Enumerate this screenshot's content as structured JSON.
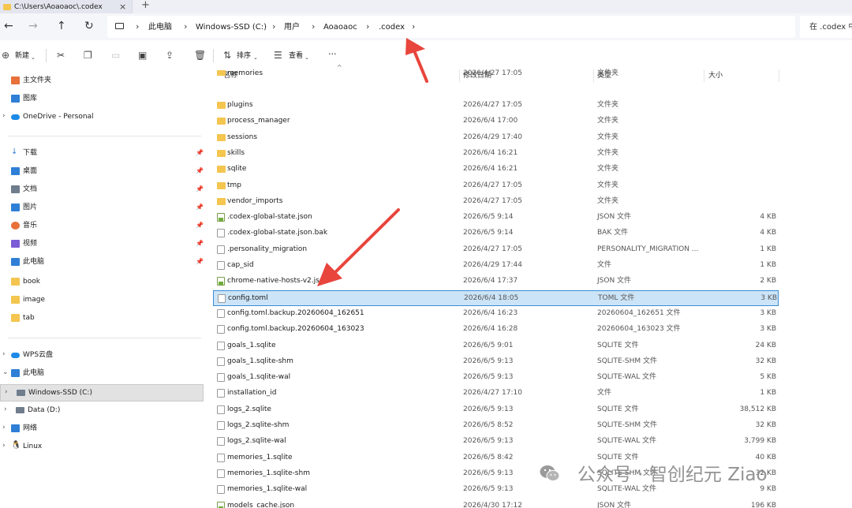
{
  "window": {
    "tab_title": "C:\\Users\\Aoaoaoc\\.codex",
    "tab_close": "×",
    "tab_add": "+"
  },
  "address": {
    "crumbs": [
      "此电脑",
      "Windows-SSD (C:)",
      "用户",
      "Aoaoaoc",
      ".codex"
    ],
    "search_placeholder": "在 .codex 中"
  },
  "toolbar": {
    "new_label": "新建",
    "sort_label": "排序",
    "view_label": "查看",
    "more_label": "···"
  },
  "sidebar": {
    "top": [
      {
        "label": "主文件夹",
        "icon": "home-icon"
      },
      {
        "label": "图库",
        "icon": "gallery-icon"
      },
      {
        "label": "OneDrive - Personal",
        "icon": "onedrive-icon"
      }
    ],
    "quick": [
      {
        "label": "下载",
        "icon": "download-icon",
        "pinned": true
      },
      {
        "label": "桌面",
        "icon": "desktop-icon",
        "pinned": true
      },
      {
        "label": "文档",
        "icon": "documents-icon",
        "pinned": true
      },
      {
        "label": "图片",
        "icon": "pictures-icon",
        "pinned": true
      },
      {
        "label": "音乐",
        "icon": "music-icon",
        "pinned": true
      },
      {
        "label": "视频",
        "icon": "videos-icon",
        "pinned": true
      },
      {
        "label": "此电脑",
        "icon": "this-pc-icon",
        "pinned": true
      },
      {
        "label": "book",
        "icon": "folder-icon",
        "pinned": false
      },
      {
        "label": "image",
        "icon": "folder-icon",
        "pinned": false
      },
      {
        "label": "tab",
        "icon": "folder-icon",
        "pinned": false
      }
    ],
    "tree": [
      {
        "label": "WPS云盘",
        "icon": "wps-cloud-icon"
      },
      {
        "label": "此电脑",
        "icon": "this-pc-icon"
      },
      {
        "label": "Windows-SSD (C:)",
        "icon": "drive-icon",
        "selected": true
      },
      {
        "label": "Data (D:)",
        "icon": "drive-icon"
      },
      {
        "label": "网络",
        "icon": "network-icon"
      },
      {
        "label": "Linux",
        "icon": "linux-icon"
      }
    ]
  },
  "columns": {
    "name": "名称",
    "date": "修改日期",
    "type": "类型",
    "size": "大小"
  },
  "files": [
    {
      "name": "memories",
      "date": "2026/4/27 17:05",
      "type": "文件夹",
      "size": "",
      "kind": "folder"
    },
    {
      "name": "plugins",
      "date": "2026/4/27 17:05",
      "type": "文件夹",
      "size": "",
      "kind": "folder"
    },
    {
      "name": "process_manager",
      "date": "2026/6/4 17:00",
      "type": "文件夹",
      "size": "",
      "kind": "folder"
    },
    {
      "name": "sessions",
      "date": "2026/4/29 17:40",
      "type": "文件夹",
      "size": "",
      "kind": "folder"
    },
    {
      "name": "skills",
      "date": "2026/6/4 16:21",
      "type": "文件夹",
      "size": "",
      "kind": "folder"
    },
    {
      "name": "sqlite",
      "date": "2026/6/4 16:21",
      "type": "文件夹",
      "size": "",
      "kind": "folder"
    },
    {
      "name": "tmp",
      "date": "2026/4/27 17:05",
      "type": "文件夹",
      "size": "",
      "kind": "folder"
    },
    {
      "name": "vendor_imports",
      "date": "2026/4/27 17:05",
      "type": "文件夹",
      "size": "",
      "kind": "folder"
    },
    {
      "name": ".codex-global-state.json",
      "date": "2026/6/5 9:14",
      "type": "JSON 文件",
      "size": "4 KB",
      "kind": "json"
    },
    {
      "name": ".codex-global-state.json.bak",
      "date": "2026/6/5 9:14",
      "type": "BAK 文件",
      "size": "4 KB",
      "kind": "doc"
    },
    {
      "name": ".personality_migration",
      "date": "2026/4/27 17:05",
      "type": "PERSONALITY_MIGRATION ...",
      "size": "1 KB",
      "kind": "doc"
    },
    {
      "name": "cap_sid",
      "date": "2026/4/29 17:44",
      "type": "文件",
      "size": "1 KB",
      "kind": "doc"
    },
    {
      "name": "chrome-native-hosts-v2.json",
      "date": "2026/6/4 17:37",
      "type": "JSON 文件",
      "size": "2 KB",
      "kind": "json"
    },
    {
      "name": "config.toml",
      "date": "2026/6/4 18:05",
      "type": "TOML 文件",
      "size": "3 KB",
      "kind": "doc",
      "selected": true
    },
    {
      "name": "config.toml.backup.20260604_162651",
      "date": "2026/6/4 16:23",
      "type": "20260604_162651 文件",
      "size": "3 KB",
      "kind": "doc"
    },
    {
      "name": "config.toml.backup.20260604_163023",
      "date": "2026/6/4 16:28",
      "type": "20260604_163023 文件",
      "size": "3 KB",
      "kind": "doc"
    },
    {
      "name": "goals_1.sqlite",
      "date": "2026/6/5 9:01",
      "type": "SQLITE 文件",
      "size": "24 KB",
      "kind": "doc"
    },
    {
      "name": "goals_1.sqlite-shm",
      "date": "2026/6/5 9:13",
      "type": "SQLITE-SHM 文件",
      "size": "32 KB",
      "kind": "doc"
    },
    {
      "name": "goals_1.sqlite-wal",
      "date": "2026/6/5 9:13",
      "type": "SQLITE-WAL 文件",
      "size": "5 KB",
      "kind": "doc"
    },
    {
      "name": "installation_id",
      "date": "2026/4/27 17:10",
      "type": "文件",
      "size": "1 KB",
      "kind": "doc"
    },
    {
      "name": "logs_2.sqlite",
      "date": "2026/6/5 9:13",
      "type": "SQLITE 文件",
      "size": "38,512 KB",
      "kind": "doc"
    },
    {
      "name": "logs_2.sqlite-shm",
      "date": "2026/6/5 8:52",
      "type": "SQLITE-SHM 文件",
      "size": "32 KB",
      "kind": "doc"
    },
    {
      "name": "logs_2.sqlite-wal",
      "date": "2026/6/5 9:13",
      "type": "SQLITE-WAL 文件",
      "size": "3,799 KB",
      "kind": "doc"
    },
    {
      "name": "memories_1.sqlite",
      "date": "2026/6/5 8:42",
      "type": "SQLITE 文件",
      "size": "40 KB",
      "kind": "doc"
    },
    {
      "name": "memories_1.sqlite-shm",
      "date": "2026/6/5 9:13",
      "type": "SQLITE-SHM 文件",
      "size": "32 KB",
      "kind": "doc"
    },
    {
      "name": "memories_1.sqlite-wal",
      "date": "2026/6/5 9:13",
      "type": "SQLITE-WAL 文件",
      "size": "9 KB",
      "kind": "doc"
    },
    {
      "name": "models_cache.json",
      "date": "2026/4/30 17:12",
      "type": "JSON 文件",
      "size": "196 KB",
      "kind": "json"
    }
  ],
  "watermark": {
    "text": "公众号 · 智创纪元 Ziao"
  },
  "colors": {
    "selection_bg": "#cce4f7",
    "selection_border": "#3a8dd6",
    "arrow": "#e8453c",
    "folder": "#f4c54f"
  }
}
